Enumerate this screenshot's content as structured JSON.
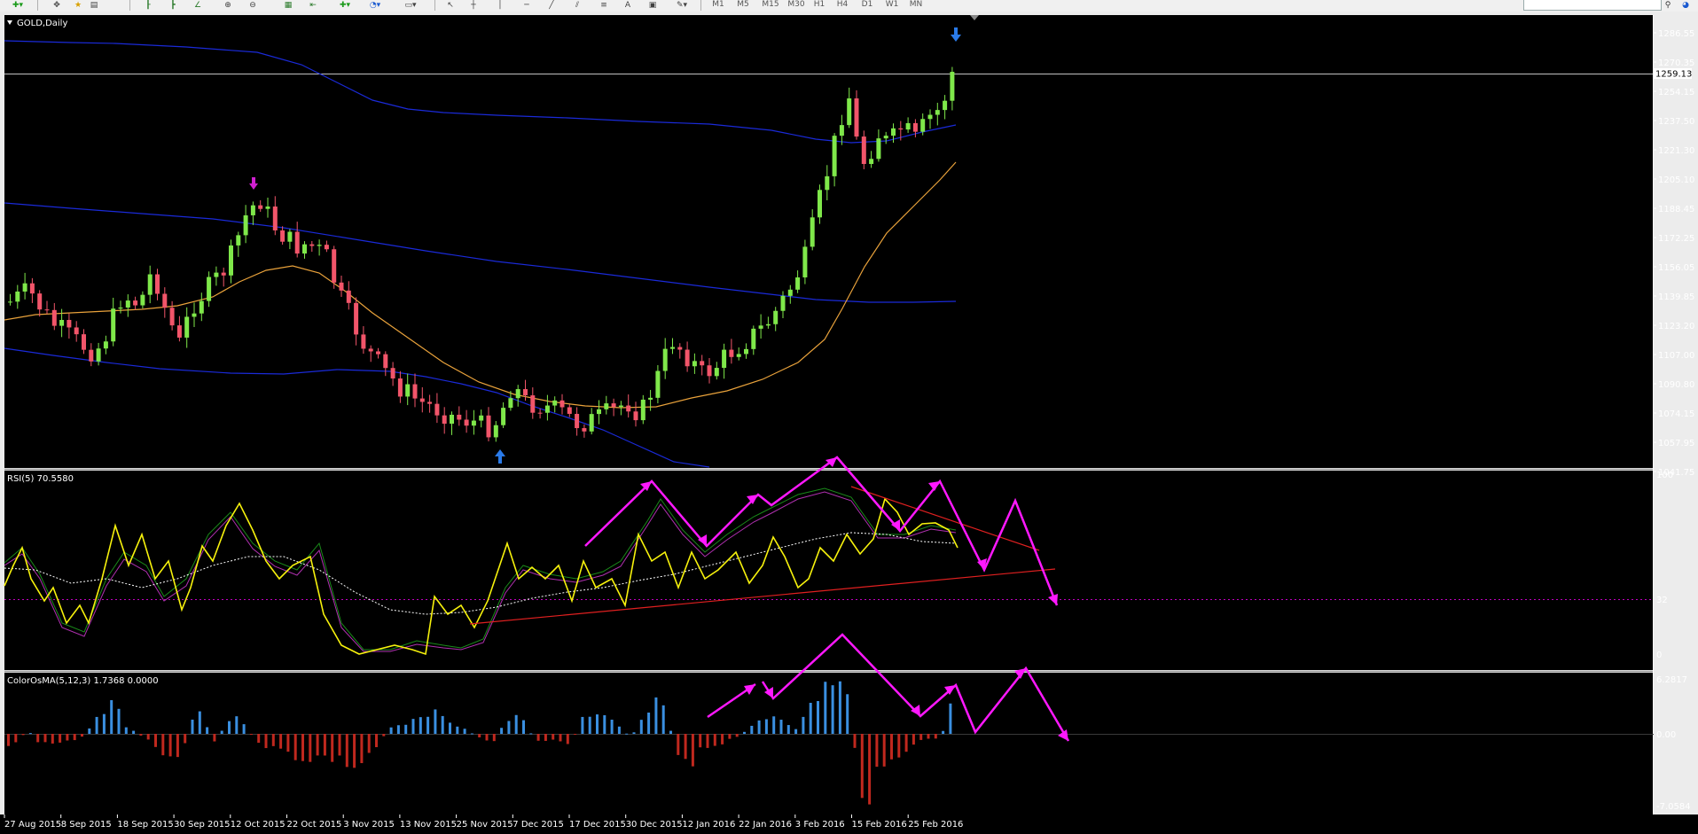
{
  "toolbar": {
    "timeframes": [
      "M1",
      "M5",
      "M15",
      "M30",
      "H1",
      "H4",
      "D1",
      "W1",
      "MN"
    ]
  },
  "chart": {
    "title": "GOLD,Daily",
    "current_price": "1259.13",
    "price_axis": [
      "1286.55",
      "1270.35",
      "1254.15",
      "1237.50",
      "1221.30",
      "1205.10",
      "1188.45",
      "1172.25",
      "1156.05",
      "1139.85",
      "1123.20",
      "1107.00",
      "1090.80",
      "1074.15",
      "1057.95",
      "1041.75"
    ],
    "date_axis": [
      "27 Aug 2015",
      "8 Sep 2015",
      "18 Sep 2015",
      "30 Sep 2015",
      "12 Oct 2015",
      "22 Oct 2015",
      "3 Nov 2015",
      "13 Nov 2015",
      "25 Nov 2015",
      "7 Dec 2015",
      "17 Dec 2015",
      "30 Dec 2015",
      "12 Jan 2016",
      "22 Jan 2016",
      "3 Feb 2016",
      "15 Feb 2016",
      "25 Feb 2016"
    ]
  },
  "rsi": {
    "label": "RSI(5) 70.5580",
    "levels": [
      "100",
      "32",
      "0"
    ]
  },
  "osma": {
    "label": "ColorOsMA(5,12,3) 1.7368 0.0000",
    "levels": [
      "6.2817",
      "0.00",
      "-7.0584"
    ]
  },
  "colors": {
    "background": "#000000",
    "bull_candle": "#7fe84a",
    "bear_candle": "#f2556a",
    "ma_blue": "#1a2ad8",
    "ma_orange": "#e9a23b",
    "rsi_line": "#f7f20c",
    "annotation": "#ff18ff",
    "trendline": "#e02020",
    "osma_up": "#3a8fe0",
    "osma_down": "#c0281e"
  }
}
